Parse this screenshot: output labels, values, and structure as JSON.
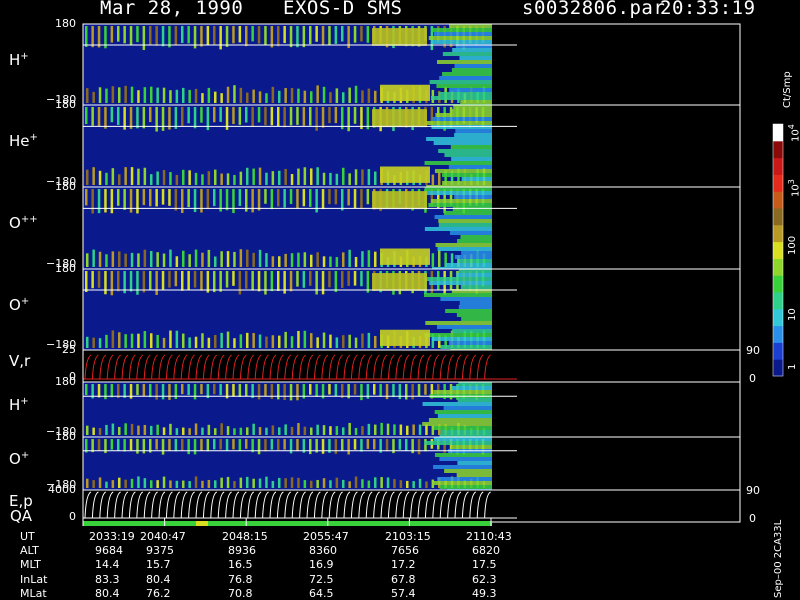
{
  "header": {
    "date": "Mar 28, 1990",
    "instrument": "EXOS-D SMS",
    "file": "s0032806.par",
    "time": "20:33:19"
  },
  "panels": [
    {
      "label": "H",
      "ion_sup": "+",
      "ymax": "180",
      "ymin": "−180"
    },
    {
      "label": "He",
      "ion_sup": "+",
      "ymax": "180",
      "ymin": "−180"
    },
    {
      "label": "O",
      "ion_sup": "++",
      "ymax": "180",
      "ymin": "−180"
    },
    {
      "label": "O",
      "ion_sup": "+",
      "ymax": "180",
      "ymin": "−180"
    },
    {
      "label": "V,r",
      "ymax": "25",
      "ymin": "0",
      "rmax": "90",
      "rmin": "0"
    },
    {
      "label": "H",
      "ion_sup": "+",
      "ymax": "180",
      "ymin": "−180"
    },
    {
      "label": "O",
      "ion_sup": "+",
      "ymax": "180",
      "ymin": "−180"
    },
    {
      "label": "E,p",
      "ymax": "4000",
      "ymin": "0",
      "rmax": "90",
      "rmin": "0"
    }
  ],
  "qa_label": "QA",
  "colorbar": {
    "unit": "Ct/Smp",
    "ticks": [
      "1",
      "10",
      "100",
      "10",
      "10"
    ],
    "tick_exps": [
      "",
      "",
      "",
      "3",
      "4"
    ],
    "colors": [
      "#0a1a8c",
      "#1c3fd2",
      "#2a8fe8",
      "#32c8d8",
      "#2fd08a",
      "#3ad23a",
      "#8fd62a",
      "#d8de20",
      "#b89a24",
      "#8a6a20",
      "#c85a1a",
      "#e82a1a",
      "#c81818",
      "#8a0a0a",
      "#ffffff"
    ]
  },
  "side_label": "Sep–00 2CA33L",
  "table": {
    "rows": [
      {
        "name": "UT",
        "values": [
          "2033:19",
          "2040:47",
          "2048:15",
          "2055:47",
          "2103:15",
          "2110:43"
        ]
      },
      {
        "name": "ALT",
        "values": [
          "9684",
          "9375",
          "8936",
          "8360",
          "7656",
          "6820"
        ]
      },
      {
        "name": "MLT",
        "values": [
          "14.4",
          "15.7",
          "16.5",
          "16.9",
          "17.2",
          "17.5"
        ]
      },
      {
        "name": "InLat",
        "values": [
          "83.3",
          "80.4",
          "76.8",
          "72.5",
          "67.8",
          "62.3"
        ]
      },
      {
        "name": "MLat",
        "values": [
          "80.4",
          "76.2",
          "70.8",
          "64.5",
          "57.4",
          "49.3"
        ]
      }
    ]
  },
  "chart_data": {
    "type": "heatmap",
    "x_axis": "UT",
    "x_ticks": [
      "2033:19",
      "2040:47",
      "2048:15",
      "2055:47",
      "2103:15",
      "2110:43"
    ],
    "colorbar_unit": "Ct/Smp",
    "colorbar_scale": "log",
    "colorbar_range": [
      1,
      10000
    ],
    "panels": [
      {
        "name": "H+",
        "ylim": [
          -180,
          180
        ]
      },
      {
        "name": "He+",
        "ylim": [
          -180,
          180
        ]
      },
      {
        "name": "O++",
        "ylim": [
          -180,
          180
        ]
      },
      {
        "name": "O+",
        "ylim": [
          -180,
          180
        ]
      },
      {
        "name": "V,r",
        "ylim": [
          0,
          25
        ],
        "right_ylim": [
          0,
          90
        ]
      },
      {
        "name": "H+",
        "ylim": [
          -180,
          180
        ]
      },
      {
        "name": "O+",
        "ylim": [
          -180,
          180
        ]
      },
      {
        "name": "E,p",
        "ylim": [
          0,
          4000
        ],
        "right_ylim": [
          0,
          90
        ]
      }
    ]
  }
}
